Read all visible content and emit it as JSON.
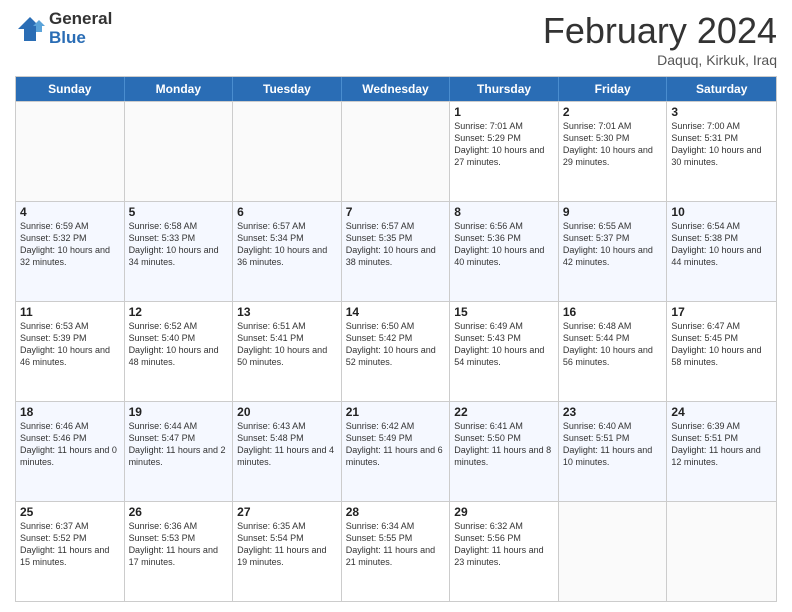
{
  "header": {
    "logo_general": "General",
    "logo_blue": "Blue",
    "title": "February 2024",
    "location": "Daquq, Kirkuk, Iraq"
  },
  "weekdays": [
    "Sunday",
    "Monday",
    "Tuesday",
    "Wednesday",
    "Thursday",
    "Friday",
    "Saturday"
  ],
  "weeks": [
    [
      {
        "day": "",
        "sunrise": "",
        "sunset": "",
        "daylight": "",
        "empty": true
      },
      {
        "day": "",
        "sunrise": "",
        "sunset": "",
        "daylight": "",
        "empty": true
      },
      {
        "day": "",
        "sunrise": "",
        "sunset": "",
        "daylight": "",
        "empty": true
      },
      {
        "day": "",
        "sunrise": "",
        "sunset": "",
        "daylight": "",
        "empty": true
      },
      {
        "day": "1",
        "sunrise": "Sunrise: 7:01 AM",
        "sunset": "Sunset: 5:29 PM",
        "daylight": "Daylight: 10 hours and 27 minutes."
      },
      {
        "day": "2",
        "sunrise": "Sunrise: 7:01 AM",
        "sunset": "Sunset: 5:30 PM",
        "daylight": "Daylight: 10 hours and 29 minutes."
      },
      {
        "day": "3",
        "sunrise": "Sunrise: 7:00 AM",
        "sunset": "Sunset: 5:31 PM",
        "daylight": "Daylight: 10 hours and 30 minutes."
      }
    ],
    [
      {
        "day": "4",
        "sunrise": "Sunrise: 6:59 AM",
        "sunset": "Sunset: 5:32 PM",
        "daylight": "Daylight: 10 hours and 32 minutes."
      },
      {
        "day": "5",
        "sunrise": "Sunrise: 6:58 AM",
        "sunset": "Sunset: 5:33 PM",
        "daylight": "Daylight: 10 hours and 34 minutes."
      },
      {
        "day": "6",
        "sunrise": "Sunrise: 6:57 AM",
        "sunset": "Sunset: 5:34 PM",
        "daylight": "Daylight: 10 hours and 36 minutes."
      },
      {
        "day": "7",
        "sunrise": "Sunrise: 6:57 AM",
        "sunset": "Sunset: 5:35 PM",
        "daylight": "Daylight: 10 hours and 38 minutes."
      },
      {
        "day": "8",
        "sunrise": "Sunrise: 6:56 AM",
        "sunset": "Sunset: 5:36 PM",
        "daylight": "Daylight: 10 hours and 40 minutes."
      },
      {
        "day": "9",
        "sunrise": "Sunrise: 6:55 AM",
        "sunset": "Sunset: 5:37 PM",
        "daylight": "Daylight: 10 hours and 42 minutes."
      },
      {
        "day": "10",
        "sunrise": "Sunrise: 6:54 AM",
        "sunset": "Sunset: 5:38 PM",
        "daylight": "Daylight: 10 hours and 44 minutes."
      }
    ],
    [
      {
        "day": "11",
        "sunrise": "Sunrise: 6:53 AM",
        "sunset": "Sunset: 5:39 PM",
        "daylight": "Daylight: 10 hours and 46 minutes."
      },
      {
        "day": "12",
        "sunrise": "Sunrise: 6:52 AM",
        "sunset": "Sunset: 5:40 PM",
        "daylight": "Daylight: 10 hours and 48 minutes."
      },
      {
        "day": "13",
        "sunrise": "Sunrise: 6:51 AM",
        "sunset": "Sunset: 5:41 PM",
        "daylight": "Daylight: 10 hours and 50 minutes."
      },
      {
        "day": "14",
        "sunrise": "Sunrise: 6:50 AM",
        "sunset": "Sunset: 5:42 PM",
        "daylight": "Daylight: 10 hours and 52 minutes."
      },
      {
        "day": "15",
        "sunrise": "Sunrise: 6:49 AM",
        "sunset": "Sunset: 5:43 PM",
        "daylight": "Daylight: 10 hours and 54 minutes."
      },
      {
        "day": "16",
        "sunrise": "Sunrise: 6:48 AM",
        "sunset": "Sunset: 5:44 PM",
        "daylight": "Daylight: 10 hours and 56 minutes."
      },
      {
        "day": "17",
        "sunrise": "Sunrise: 6:47 AM",
        "sunset": "Sunset: 5:45 PM",
        "daylight": "Daylight: 10 hours and 58 minutes."
      }
    ],
    [
      {
        "day": "18",
        "sunrise": "Sunrise: 6:46 AM",
        "sunset": "Sunset: 5:46 PM",
        "daylight": "Daylight: 11 hours and 0 minutes."
      },
      {
        "day": "19",
        "sunrise": "Sunrise: 6:44 AM",
        "sunset": "Sunset: 5:47 PM",
        "daylight": "Daylight: 11 hours and 2 minutes."
      },
      {
        "day": "20",
        "sunrise": "Sunrise: 6:43 AM",
        "sunset": "Sunset: 5:48 PM",
        "daylight": "Daylight: 11 hours and 4 minutes."
      },
      {
        "day": "21",
        "sunrise": "Sunrise: 6:42 AM",
        "sunset": "Sunset: 5:49 PM",
        "daylight": "Daylight: 11 hours and 6 minutes."
      },
      {
        "day": "22",
        "sunrise": "Sunrise: 6:41 AM",
        "sunset": "Sunset: 5:50 PM",
        "daylight": "Daylight: 11 hours and 8 minutes."
      },
      {
        "day": "23",
        "sunrise": "Sunrise: 6:40 AM",
        "sunset": "Sunset: 5:51 PM",
        "daylight": "Daylight: 11 hours and 10 minutes."
      },
      {
        "day": "24",
        "sunrise": "Sunrise: 6:39 AM",
        "sunset": "Sunset: 5:51 PM",
        "daylight": "Daylight: 11 hours and 12 minutes."
      }
    ],
    [
      {
        "day": "25",
        "sunrise": "Sunrise: 6:37 AM",
        "sunset": "Sunset: 5:52 PM",
        "daylight": "Daylight: 11 hours and 15 minutes."
      },
      {
        "day": "26",
        "sunrise": "Sunrise: 6:36 AM",
        "sunset": "Sunset: 5:53 PM",
        "daylight": "Daylight: 11 hours and 17 minutes."
      },
      {
        "day": "27",
        "sunrise": "Sunrise: 6:35 AM",
        "sunset": "Sunset: 5:54 PM",
        "daylight": "Daylight: 11 hours and 19 minutes."
      },
      {
        "day": "28",
        "sunrise": "Sunrise: 6:34 AM",
        "sunset": "Sunset: 5:55 PM",
        "daylight": "Daylight: 11 hours and 21 minutes."
      },
      {
        "day": "29",
        "sunrise": "Sunrise: 6:32 AM",
        "sunset": "Sunset: 5:56 PM",
        "daylight": "Daylight: 11 hours and 23 minutes."
      },
      {
        "day": "",
        "sunrise": "",
        "sunset": "",
        "daylight": "",
        "empty": true
      },
      {
        "day": "",
        "sunrise": "",
        "sunset": "",
        "daylight": "",
        "empty": true
      }
    ]
  ]
}
